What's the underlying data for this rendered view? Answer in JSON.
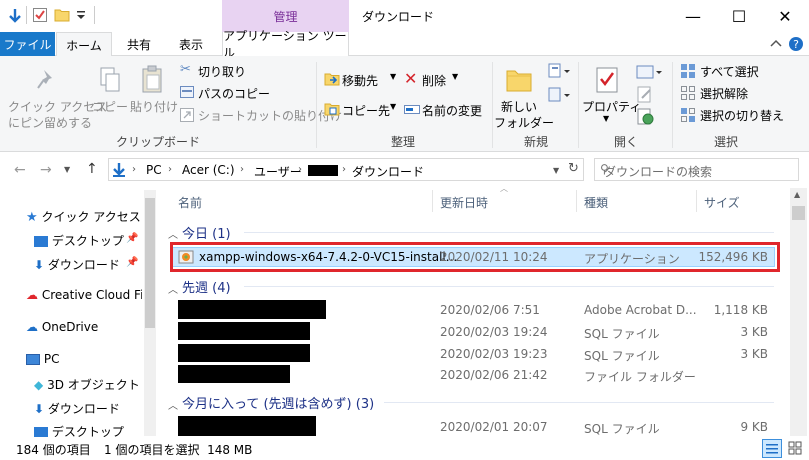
{
  "titlebar": {
    "manage_tab": "管理",
    "window_title": "ダウンロード",
    "minimize": "—",
    "maximize": "☐",
    "close": "✕"
  },
  "tabs": {
    "file": "ファイル",
    "home": "ホーム",
    "share": "共有",
    "view": "表示",
    "app_tools": "アプリケーション ツール"
  },
  "ribbon": {
    "clipboard": {
      "pin_quick_access": [
        "クイック アクセス",
        "にピン留めする"
      ],
      "copy": "コピー",
      "paste": "貼り付け",
      "cut": "切り取り",
      "copy_path": "パスのコピー",
      "paste_shortcut": "ショートカットの貼り付け",
      "label": "クリップボード"
    },
    "organize": {
      "move_to": "移動先",
      "delete": "削除",
      "copy_to": "コピー先",
      "rename": "名前の変更",
      "label": "整理"
    },
    "new": {
      "new_folder": [
        "新しい",
        "フォルダー"
      ],
      "label": "新規"
    },
    "open": {
      "properties": "プロパティ",
      "label": "開く"
    },
    "select": {
      "select_all": "すべて選択",
      "select_none": "選択解除",
      "invert_selection": "選択の切り替え",
      "label": "選択"
    }
  },
  "address": {
    "crumbs": [
      "PC",
      "Acer (C:)",
      "ユーザー",
      "ダウンロード"
    ],
    "search_placeholder": "ダウンロードの検索"
  },
  "nav": {
    "quick_access": "クイック アクセス",
    "desktop": "デスクトップ",
    "downloads": "ダウンロード",
    "creative_cloud": "Creative Cloud Files",
    "onedrive": "OneDrive",
    "pc": "PC",
    "objects_3d": "3D オブジェクト",
    "downloads2": "ダウンロード",
    "desktop2": "デスクトップ"
  },
  "columns": {
    "name": "名前",
    "modified": "更新日時",
    "type": "種類",
    "size": "サイズ"
  },
  "groups": {
    "today": "今日 (1)",
    "last_week": "先週 (4)",
    "this_month": "今月に入って (先週は含めず) (3)"
  },
  "files": {
    "today": [
      {
        "name": "xampp-windows-x64-7.4.2-0-VC15-install...",
        "date": "2020/02/11 10:24",
        "type": "アプリケーション",
        "size": "152,496 KB"
      }
    ],
    "last_week": [
      {
        "date": "2020/02/06 7:51",
        "type": "Adobe Acrobat D...",
        "size": "1,118 KB"
      },
      {
        "date": "2020/02/03 19:24",
        "type": "SQL ファイル",
        "size": "3 KB"
      },
      {
        "date": "2020/02/03 19:23",
        "type": "SQL ファイル",
        "size": "3 KB"
      },
      {
        "date": "2020/02/06 21:42",
        "type": "ファイル フォルダー",
        "size": ""
      }
    ],
    "this_month": [
      {
        "date": "2020/02/01 20:07",
        "type": "SQL ファイル",
        "size": "9 KB"
      }
    ]
  },
  "status": {
    "item_count": "184 個の項目",
    "selected": "1 個の項目を選択  148 MB"
  }
}
